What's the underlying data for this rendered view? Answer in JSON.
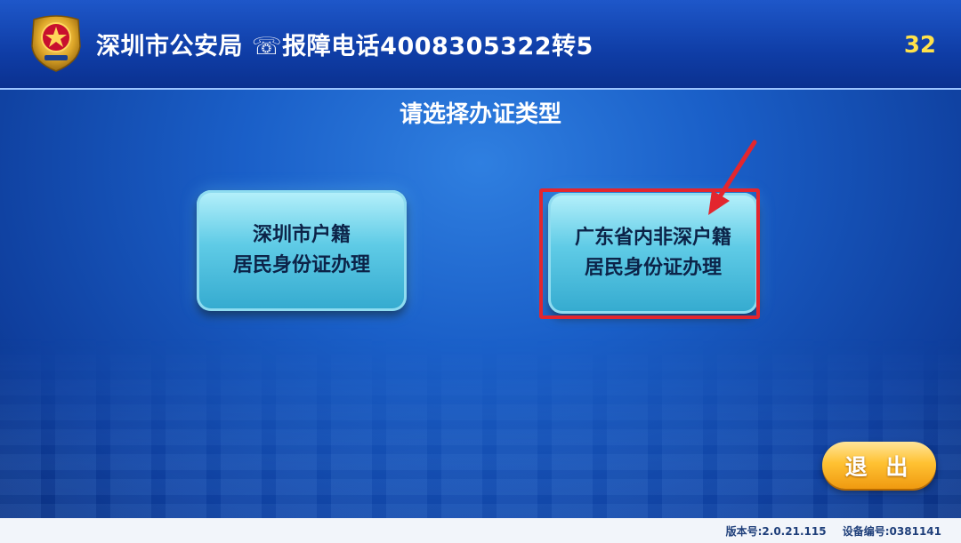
{
  "header": {
    "title": "深圳市公安局 ☏报障电话4008305322转5",
    "countdown": "32",
    "emblem_icon": "police-emblem-icon"
  },
  "main": {
    "prompt": "请选择办证类型",
    "options": [
      {
        "line1": "深圳市户籍",
        "line2": "居民身份证办理"
      },
      {
        "line1": "广东省内非深户籍",
        "line2": "居民身份证办理"
      }
    ],
    "highlight_color": "#e3262e"
  },
  "exit_button": {
    "label": "退 出"
  },
  "footer": {
    "version": "版本号:2.0.21.115",
    "device": "设备编号:0381141"
  }
}
